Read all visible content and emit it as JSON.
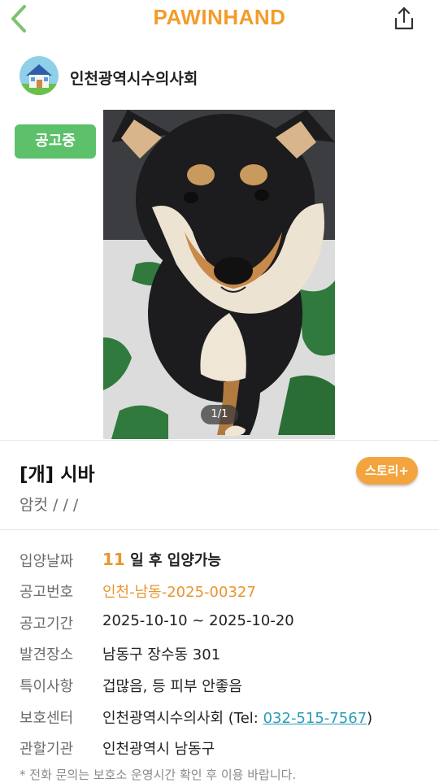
{
  "header": {
    "brand": "PAWINHAND",
    "back_icon": "chevron-left-icon",
    "share_icon": "share-icon",
    "accent_color": "#f39c2b"
  },
  "shelter": {
    "name": "인천광역시수의사회",
    "avatar_icon": "house-icon"
  },
  "status": {
    "label": "공고중",
    "color": "#5cc16a"
  },
  "photo": {
    "counter": "1/1"
  },
  "animal": {
    "title": "[개] 시바",
    "subtitle": "암컷 /  /  /",
    "story_button": "스토리+"
  },
  "details": {
    "adoption_date": {
      "label": "입양날짜",
      "days": "11",
      "suffix": " 일 후 입양가능"
    },
    "notice_number": {
      "label": "공고번호",
      "value": "인천-남동-2025-00327"
    },
    "notice_period": {
      "label": "공고기간",
      "value": "2025-10-10 ~ 2025-10-20"
    },
    "found_place": {
      "label": "발견장소",
      "value": "남동구 장수동 301"
    },
    "special_notes": {
      "label": "특이사항",
      "value": "겁많음, 등 피부 안좋음"
    },
    "care_center": {
      "label": "보호센터",
      "value_prefix": "인천광역시수의사회 (Tel: ",
      "tel": "032-515-7567",
      "value_suffix": ")"
    },
    "authority": {
      "label": "관할기관",
      "value": "인천광역시 남동구"
    }
  },
  "footnote": "* 전화 문의는 보호소 운영시간 확인 후 이용 바랍니다."
}
